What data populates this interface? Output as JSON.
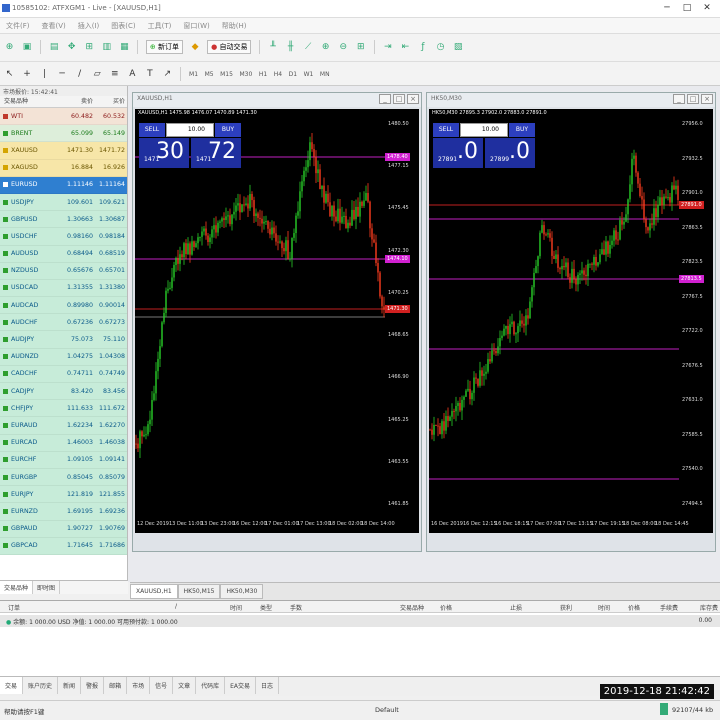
{
  "window": {
    "title": "10585102: ATFXGM1 - Live - [XAUUSD,H1]"
  },
  "menu": [
    "文件(F)",
    "查看(V)",
    "插入(I)",
    "图表(C)",
    "工具(T)",
    "窗口(W)",
    "帮助(H)"
  ],
  "toolbar": {
    "new_order": "新订单",
    "autotrade": "自动交易",
    "periods": [
      "M1",
      "M5",
      "M15",
      "M30",
      "H1",
      "H4",
      "D1",
      "W1",
      "MN"
    ]
  },
  "market_watch": {
    "title": "市场报价: 15:42:41",
    "col_symbol": "交易品种",
    "col_bid": "卖价",
    "col_ask": "买价",
    "rows": [
      {
        "symbol": "WTI",
        "bid": "60.482",
        "ask": "60.532",
        "bg": "#f3e3d6",
        "color": "#8b1a1a",
        "icon": "#c0392b"
      },
      {
        "symbol": "BRENT",
        "bid": "65.099",
        "ask": "65.149",
        "bg": "#ddeeda",
        "color": "#1a7a1a",
        "icon": "#2e9e2e"
      },
      {
        "symbol": "XAUUSD",
        "bid": "1471.30",
        "ask": "1471.72",
        "bg": "#f7e6a8",
        "color": "#6a5600",
        "icon": "#d4a400"
      },
      {
        "symbol": "XAGUSD",
        "bid": "16.884",
        "ask": "16.926",
        "bg": "#f7e6a8",
        "color": "#6a5600",
        "icon": "#d4a400"
      },
      {
        "symbol": "EURUSD",
        "bid": "1.11146",
        "ask": "1.11164",
        "bg": "#2f7fd0",
        "color": "#ffffff",
        "icon": "#ffffff"
      },
      {
        "symbol": "USDJPY",
        "bid": "109.601",
        "ask": "109.621",
        "bg": "#c7ecd9",
        "color": "#0a5a8a",
        "icon": "#2e9e2e"
      },
      {
        "symbol": "GBPUSD",
        "bid": "1.30663",
        "ask": "1.30687",
        "bg": "#c7ecd9",
        "color": "#0a5a8a",
        "icon": "#2e9e2e"
      },
      {
        "symbol": "USDCHF",
        "bid": "0.98160",
        "ask": "0.98184",
        "bg": "#c7ecd9",
        "color": "#0a5a8a",
        "icon": "#2e9e2e"
      },
      {
        "symbol": "AUDUSD",
        "bid": "0.68494",
        "ask": "0.68519",
        "bg": "#c7ecd9",
        "color": "#0a5a8a",
        "icon": "#2e9e2e"
      },
      {
        "symbol": "NZDUSD",
        "bid": "0.65676",
        "ask": "0.65701",
        "bg": "#c7ecd9",
        "color": "#0a5a8a",
        "icon": "#2e9e2e"
      },
      {
        "symbol": "USDCAD",
        "bid": "1.31355",
        "ask": "1.31380",
        "bg": "#c7ecd9",
        "color": "#0a5a8a",
        "icon": "#2e9e2e"
      },
      {
        "symbol": "AUDCAD",
        "bid": "0.89980",
        "ask": "0.90014",
        "bg": "#c7ecd9",
        "color": "#0a5a8a",
        "icon": "#2e9e2e"
      },
      {
        "symbol": "AUDCHF",
        "bid": "0.67236",
        "ask": "0.67273",
        "bg": "#c7ecd9",
        "color": "#0a5a8a",
        "icon": "#2e9e2e"
      },
      {
        "symbol": "AUDJPY",
        "bid": "75.073",
        "ask": "75.110",
        "bg": "#c7ecd9",
        "color": "#0a5a8a",
        "icon": "#2e9e2e"
      },
      {
        "symbol": "AUDNZD",
        "bid": "1.04275",
        "ask": "1.04308",
        "bg": "#c7ecd9",
        "color": "#0a5a8a",
        "icon": "#2e9e2e"
      },
      {
        "symbol": "CADCHF",
        "bid": "0.74711",
        "ask": "0.74749",
        "bg": "#c7ecd9",
        "color": "#0a5a8a",
        "icon": "#2e9e2e"
      },
      {
        "symbol": "CADJPY",
        "bid": "83.420",
        "ask": "83.456",
        "bg": "#c7ecd9",
        "color": "#0a5a8a",
        "icon": "#2e9e2e"
      },
      {
        "symbol": "CHFJPY",
        "bid": "111.633",
        "ask": "111.672",
        "bg": "#c7ecd9",
        "color": "#0a5a8a",
        "icon": "#2e9e2e"
      },
      {
        "symbol": "EURAUD",
        "bid": "1.62234",
        "ask": "1.62270",
        "bg": "#c7ecd9",
        "color": "#0a5a8a",
        "icon": "#2e9e2e"
      },
      {
        "symbol": "EURCAD",
        "bid": "1.46003",
        "ask": "1.46038",
        "bg": "#c7ecd9",
        "color": "#0a5a8a",
        "icon": "#2e9e2e"
      },
      {
        "symbol": "EURCHF",
        "bid": "1.09105",
        "ask": "1.09141",
        "bg": "#c7ecd9",
        "color": "#0a5a8a",
        "icon": "#2e9e2e"
      },
      {
        "symbol": "EURGBP",
        "bid": "0.85045",
        "ask": "0.85079",
        "bg": "#c7ecd9",
        "color": "#0a5a8a",
        "icon": "#2e9e2e"
      },
      {
        "symbol": "EURJPY",
        "bid": "121.819",
        "ask": "121.855",
        "bg": "#c7ecd9",
        "color": "#0a5a8a",
        "icon": "#2e9e2e"
      },
      {
        "symbol": "EURNZD",
        "bid": "1.69195",
        "ask": "1.69236",
        "bg": "#c7ecd9",
        "color": "#0a5a8a",
        "icon": "#2e9e2e"
      },
      {
        "symbol": "GBPAUD",
        "bid": "1.90727",
        "ask": "1.90769",
        "bg": "#c7ecd9",
        "color": "#0a5a8a",
        "icon": "#2e9e2e"
      },
      {
        "symbol": "GBPCAD",
        "bid": "1.71645",
        "ask": "1.71686",
        "bg": "#c7ecd9",
        "color": "#0a5a8a",
        "icon": "#2e9e2e"
      }
    ],
    "tabs": [
      "交易品种",
      "即时图"
    ]
  },
  "charts": [
    {
      "title": "XAUUSD,H1",
      "ohlc": "XAUUSD,H1  1475.98 1476.07 1470.89 1471.30",
      "sell_label": "SELL",
      "buy_label": "BUY",
      "lot": "10.00",
      "sell_small": "1471",
      "sell_big": "30",
      "buy_small": "1471",
      "buy_big": "72",
      "price_ticks": [
        "1480.50",
        "1477.15",
        "1475.45",
        "1472.30",
        "1470.25",
        "1468.65",
        "1466.90",
        "1465.25",
        "1463.55",
        "1461.85"
      ],
      "time_ticks": [
        "12 Dec 2019",
        "13 Dec 11:00",
        "13 Dec 23:00",
        "16 Dec 12:00",
        "17 Dec 01:00",
        "17 Dec 13:00",
        "18 Dec 02:00",
        "18 Dec 14:00"
      ],
      "markers": [
        {
          "label": "1478.40",
          "color": "#d020d0"
        },
        {
          "label": "1474.10",
          "color": "#d020d0"
        },
        {
          "label": "1471.30",
          "color": "#d02020"
        }
      ]
    },
    {
      "title": "HK50,M30",
      "ohlc": "HK50,M30  27895.3 27902.0 27883.0 27891.0",
      "sell_label": "SELL",
      "buy_label": "BUY",
      "lot": "10.00",
      "sell_small": "27891",
      "sell_big": ".0",
      "buy_small": "27899",
      "buy_big": ".0",
      "price_ticks": [
        "27956.0",
        "27932.5",
        "27901.0",
        "27863.5",
        "27823.5",
        "27767.5",
        "27722.0",
        "27676.5",
        "27631.0",
        "27585.5",
        "27540.0",
        "27494.5"
      ],
      "time_ticks": [
        "16 Dec 2019",
        "16 Dec 12:15",
        "16 Dec 18:15",
        "17 Dec 07:00",
        "17 Dec 13:15",
        "17 Dec 19:15",
        "18 Dec 08:00",
        "18 Dec 14:45"
      ],
      "markers": [
        {
          "label": "27891.0",
          "color": "#d02020"
        },
        {
          "label": "27813.5",
          "color": "#d020d0"
        }
      ]
    }
  ],
  "chart_tabs": [
    "XAUUSD,H1",
    "HK50,M15",
    "HK50,M30"
  ],
  "terminal": {
    "headers": [
      "订单",
      "/",
      "时间",
      "类型",
      "手数",
      "交易品种",
      "价格",
      "止损",
      "获利",
      "时间",
      "价格",
      "手续费",
      "库存费",
      "获利"
    ],
    "balance_row": "余额: 1 000.00 USD  净值: 1 000.00  可用预付款: 1 000.00",
    "balance_profit": "0.00",
    "tabs": [
      "交易",
      "账户历史",
      "新闻",
      "警报",
      "邮箱",
      "市场",
      "信号",
      "文章",
      "代码库",
      "EA交易",
      "日志"
    ]
  },
  "clock": "2019-12-18  21:42:42",
  "status": {
    "help": "帮助请按F1键",
    "profile": "Default",
    "traffic": "92107/44 kb"
  }
}
